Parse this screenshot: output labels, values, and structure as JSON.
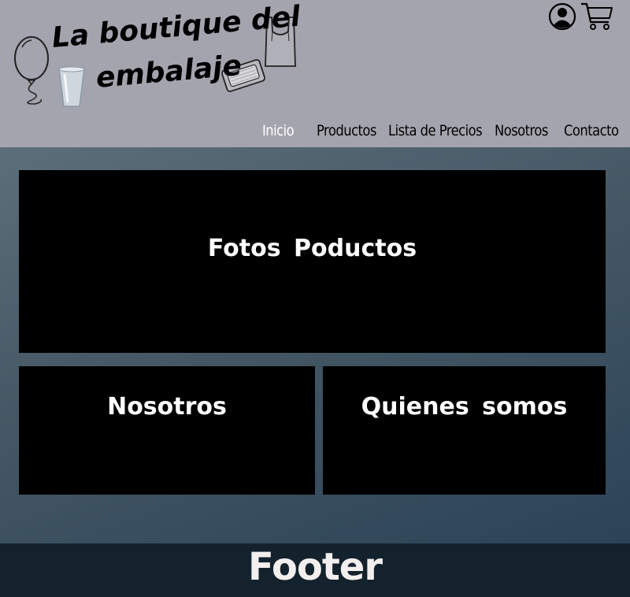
{
  "header": {
    "logo": {
      "line1": "La boutique del",
      "line2": "embalaje",
      "icons": [
        "balloon-icon",
        "plastic-cup-icon",
        "plastic-bag-icon",
        "aluminum-tray-icon"
      ]
    },
    "icons": {
      "user": "user-icon",
      "cart": "cart-icon"
    }
  },
  "nav": {
    "items": [
      {
        "label": "Inicio",
        "active": true
      },
      {
        "label": "Productos",
        "active": false
      },
      {
        "label": "Lista de Precios",
        "active": false
      },
      {
        "label": "Nosotros",
        "active": false
      },
      {
        "label": "Contacto",
        "active": false
      }
    ]
  },
  "main": {
    "panels": {
      "fotos": "Fotos Poductos",
      "nosotros": "Nosotros",
      "quienes": "Quienes somos"
    }
  },
  "footer": {
    "label": "Footer"
  },
  "colors": {
    "header_bg": "#a4a4ae",
    "panel_bg": "#000000",
    "footer_bg": "#13222c",
    "nav_active": "#ffffff"
  }
}
